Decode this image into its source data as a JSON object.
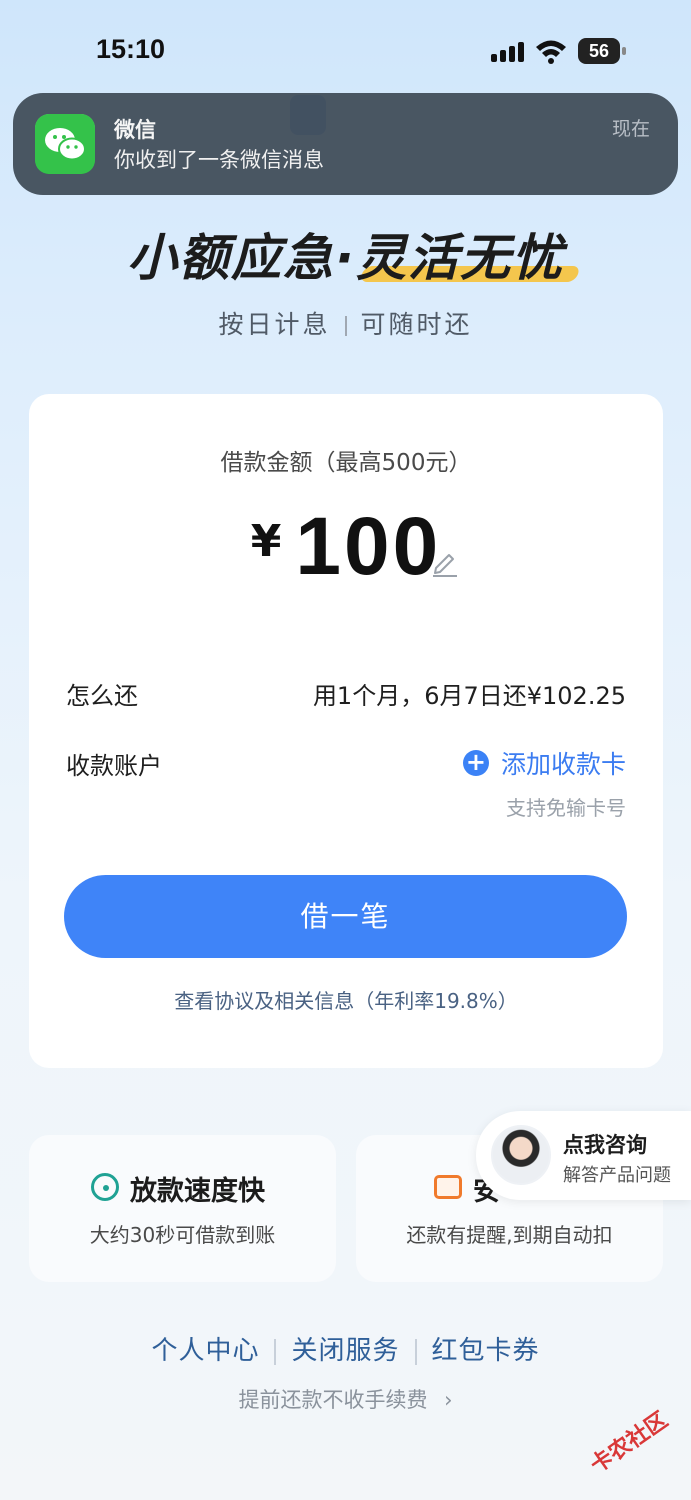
{
  "status_bar": {
    "time": "15:10",
    "battery": "56"
  },
  "notification": {
    "app": "微信",
    "message": "你收到了一条微信消息",
    "time": "现在"
  },
  "hero": {
    "title": "小额应急·灵活无忧",
    "sub_left": "按日计息",
    "sub_right": "可随时还"
  },
  "loan": {
    "amount_label": "借款金额（最高500元）",
    "currency": "¥",
    "amount": "100",
    "repay_label": "怎么还",
    "repay_value": "用1个月，6月7日还¥102.25",
    "account_label": "收款账户",
    "add_card_label": "添加收款卡",
    "add_card_hint": "支持免输卡号",
    "borrow_button": "借一笔",
    "agreement": "查看协议及相关信息（年利率19.8%）"
  },
  "features": {
    "left_title": "放款速度快",
    "left_desc": "大约30秒可借款到账",
    "right_title": "安",
    "right_desc": "还款有提醒,到期自动扣"
  },
  "consult": {
    "title": "点我咨询",
    "subtitle": "解答产品问题"
  },
  "bottom_nav": {
    "personal": "个人中心",
    "close": "关闭服务",
    "coupons": "红包卡券"
  },
  "prepay_note": "提前还款不收手续费",
  "watermark": "卡农社区",
  "colors": {
    "primary": "#3f84f8",
    "link": "#2f5f99",
    "accent": "#f6c23a"
  }
}
